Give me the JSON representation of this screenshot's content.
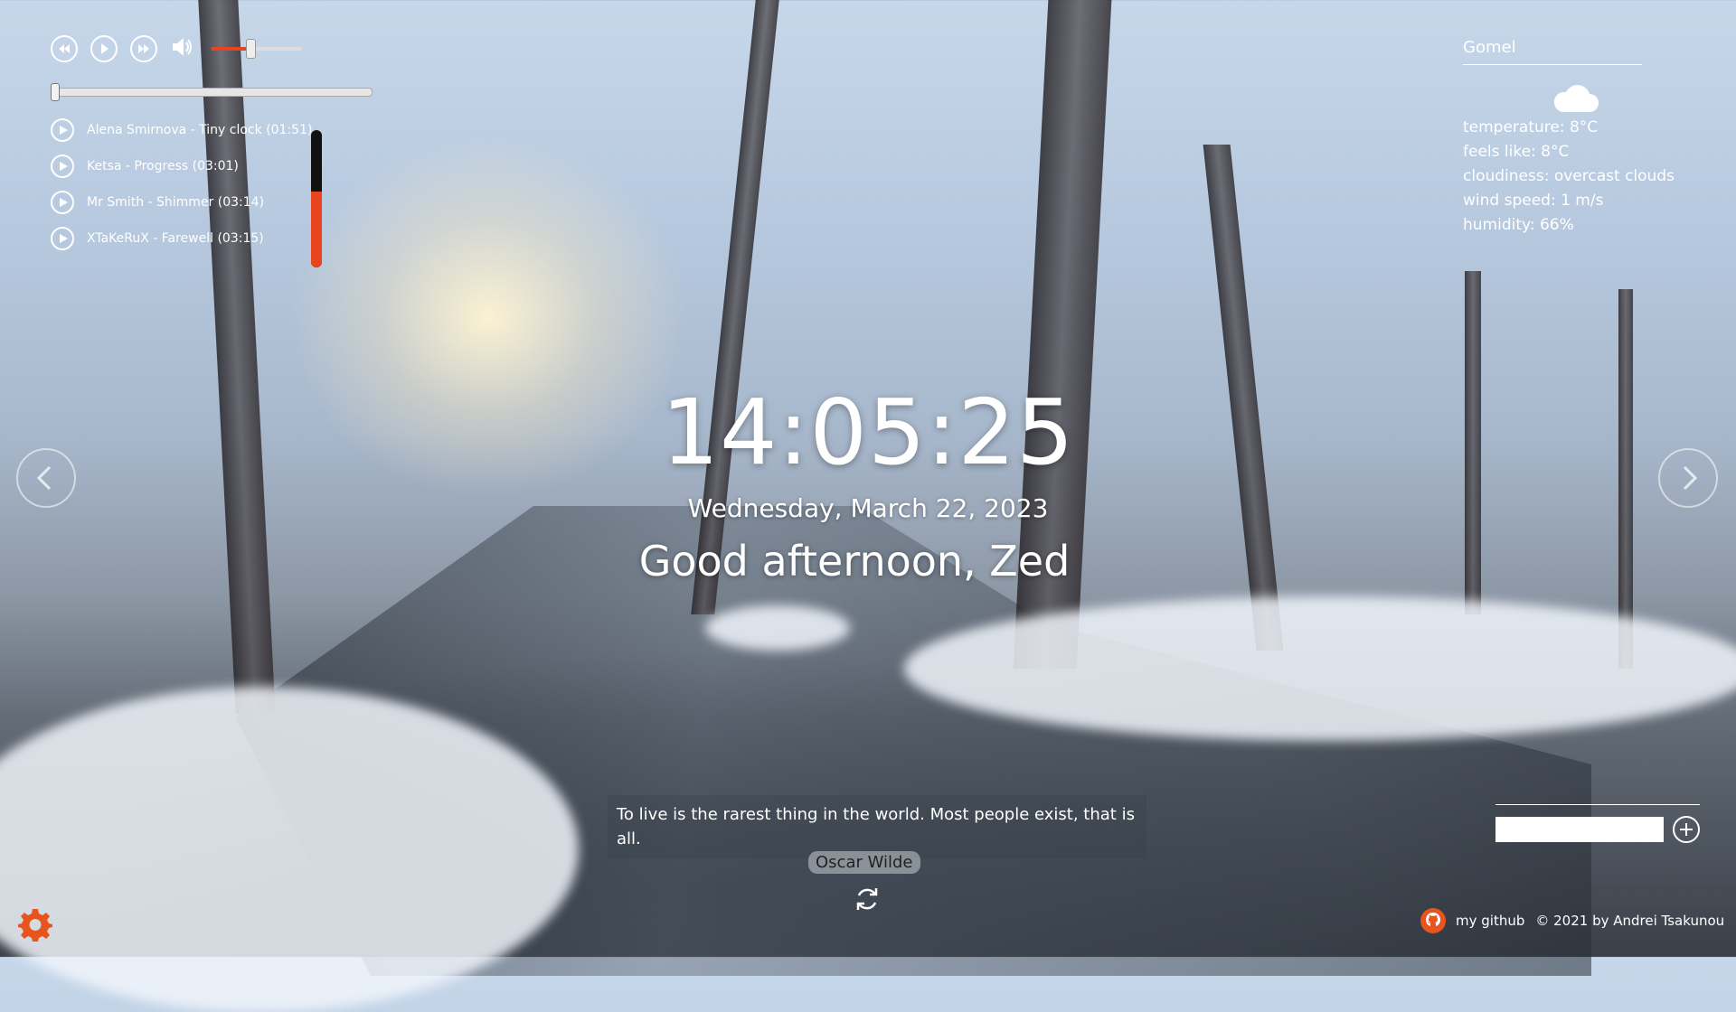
{
  "player": {
    "volume_level": 0.42,
    "progress": 0.0,
    "playlist": [
      {
        "title": "Alena Smirnova - Tiny clock (01:51)"
      },
      {
        "title": "Ketsa - Progress (03:01)"
      },
      {
        "title": "Mr Smith - Shimmer (03:14)"
      },
      {
        "title": "XTaKeRuX - Farewell (03:15)"
      }
    ],
    "visualizer_level": 0.55
  },
  "weather": {
    "city": "Gomel",
    "icon": "cloud-icon",
    "temperature": "temperature: 8°C",
    "feels_like": "feels like: 8°C",
    "cloudiness": "cloudiness: overcast clouds",
    "wind": "wind speed: 1 m/s",
    "humidity": "humidity: 66%"
  },
  "clock": {
    "time": "14:05:25",
    "date": "Wednesday, March 22, 2023",
    "greeting": "Good afternoon, Zed"
  },
  "quote": {
    "text": "To live is the rarest thing in the world. Most people exist, that is all.",
    "author": "Oscar Wilde"
  },
  "todo": {
    "input_value": ""
  },
  "footer": {
    "github_label": "my github",
    "copyright": "© 2021 by Andrei Tsakunou"
  },
  "colors": {
    "accent": "#e8451e",
    "text": "#ffffff"
  }
}
